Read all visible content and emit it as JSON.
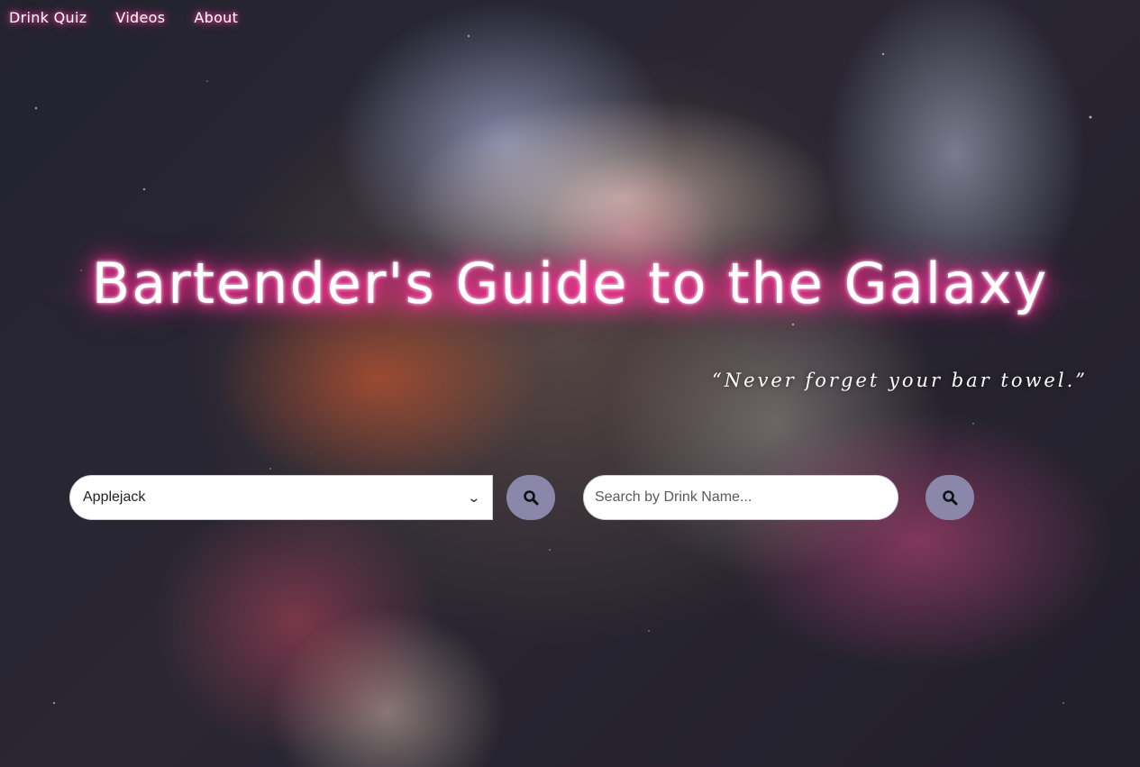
{
  "nav": {
    "items": [
      {
        "label": "Drink Quiz"
      },
      {
        "label": "Videos"
      },
      {
        "label": "About"
      }
    ]
  },
  "hero": {
    "title": "Bartender's Guide to the Galaxy",
    "tagline": "“Never forget your bar towel.”"
  },
  "search": {
    "ingredient_selected": "Applejack",
    "name_placeholder": "Search by Drink Name...",
    "button_icon": "search-icon"
  },
  "colors": {
    "title_glow": "#ff2d95",
    "search_button": "#8a87ab",
    "input_background": "#ffffff"
  }
}
